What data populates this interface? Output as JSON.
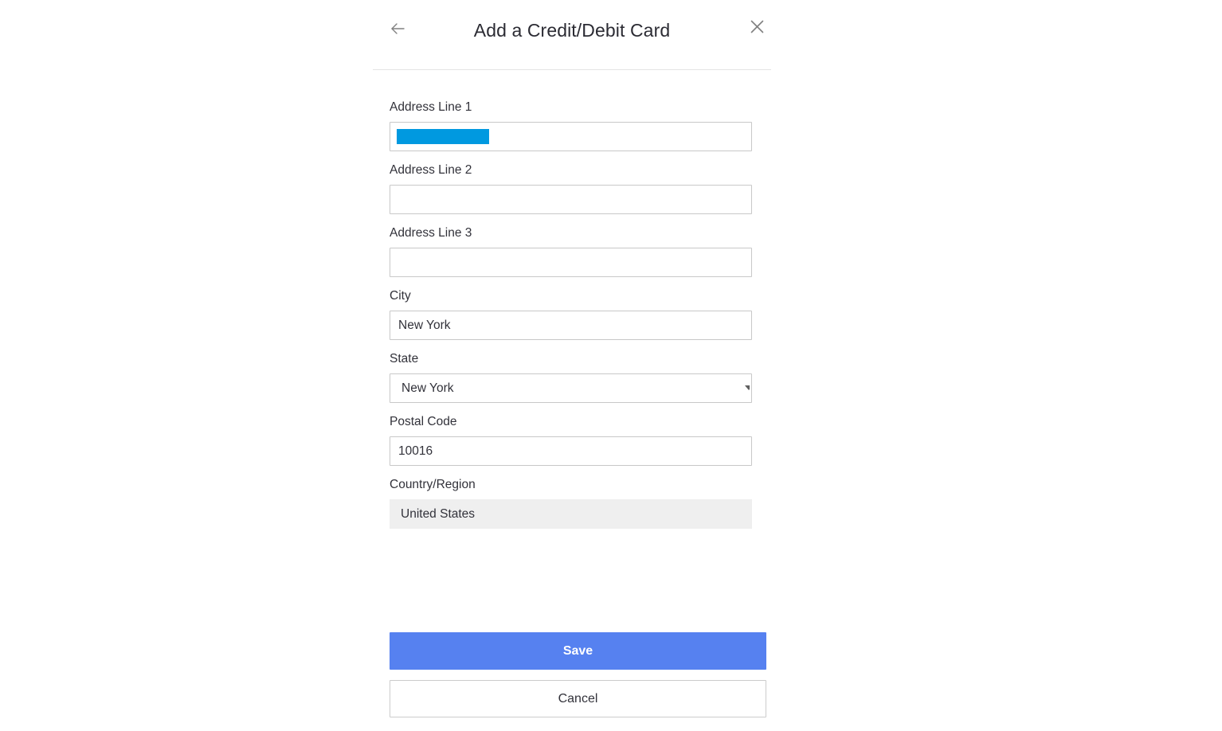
{
  "dialog": {
    "title": "Add a Credit/Debit Card",
    "back_icon": "arrow-left-icon",
    "close_icon": "close-icon"
  },
  "form": {
    "fields": [
      {
        "key": "address_line_1",
        "label": "Address Line 1",
        "value": "",
        "placeholder": "",
        "type": "text",
        "state": "text-selected"
      },
      {
        "key": "address_line_2",
        "label": "Address Line 2",
        "value": "",
        "placeholder": "",
        "type": "text",
        "state": "empty"
      },
      {
        "key": "address_line_3",
        "label": "Address Line 3",
        "value": "",
        "placeholder": "",
        "type": "text",
        "state": "empty"
      },
      {
        "key": "city",
        "label": "City",
        "value": "New York",
        "placeholder": "",
        "type": "text",
        "state": "filled"
      },
      {
        "key": "state",
        "label": "State",
        "value": "New York",
        "placeholder": "",
        "type": "select",
        "state": "filled"
      },
      {
        "key": "postal_code",
        "label": "Postal Code",
        "value": "10016",
        "placeholder": "",
        "type": "text",
        "state": "filled"
      },
      {
        "key": "country_region",
        "label": "Country/Region",
        "value": "United States",
        "placeholder": "",
        "type": "readonly",
        "state": "disabled"
      }
    ]
  },
  "actions": {
    "save_label": "Save",
    "cancel_label": "Cancel"
  },
  "colors": {
    "selection_highlight": "#0099e0",
    "save_button": "#5681f0",
    "label_text": "#32323a",
    "input_border": "#c8c8c8",
    "readonly_background": "#efefef",
    "divider": "#e4e4e4",
    "icon_grey": "#808080",
    "page_background": "#ffffff"
  }
}
